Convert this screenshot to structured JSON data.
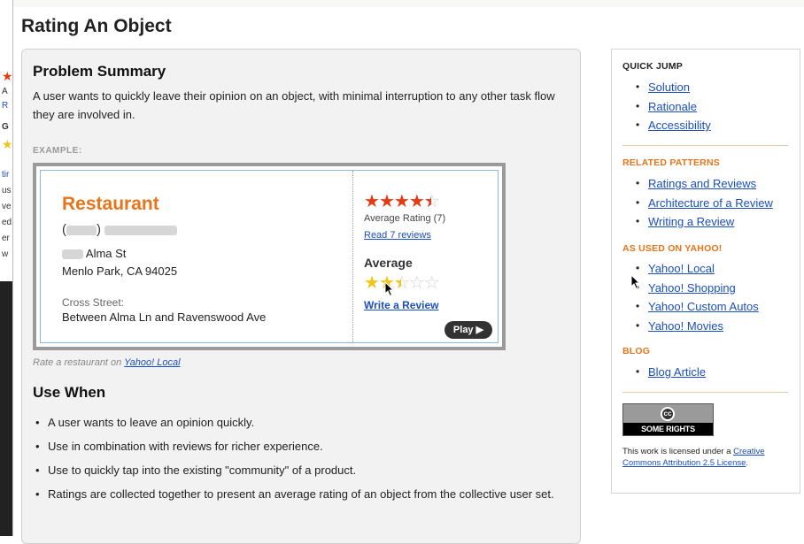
{
  "page": {
    "title": "Rating An Object"
  },
  "problem_summary": {
    "heading": "Problem Summary",
    "text": "A user wants to quickly leave their opinion on an object, with minimal interruption to any other task flow they are involved in."
  },
  "example": {
    "label": "EXAMPLE:",
    "restaurant_name": "Restaurant",
    "street": "Alma St",
    "city": "Menlo Park, CA 94025",
    "cross_street_label": "Cross Street:",
    "cross_street_value": "Between Alma Ln and Ravenswood Ave",
    "avg_rating_stars": 4.5,
    "avg_rating_text": "Average Rating (7)",
    "read_reviews_link": "Read 7 reviews",
    "user_rating_label": "Average",
    "user_rating_stars": 2.5,
    "write_review_link": "Write a Review",
    "play_button": "Play ▶",
    "caption_prefix": "Rate a restaurant on",
    "caption_link": "Yahoo! Local"
  },
  "use_when": {
    "heading": "Use When",
    "items": [
      "A user wants to leave an opinion quickly.",
      "Use in combination with reviews for richer experience.",
      "Use to quickly tap into the existing \"community\" of a product.",
      "Ratings are collected together to present an average rating of an object from the collective user set."
    ]
  },
  "sidebar": {
    "quick_jump": {
      "heading": "QUICK JUMP",
      "items": [
        "Solution",
        "Rationale",
        "Accessibility"
      ]
    },
    "related_patterns": {
      "heading": "RELATED PATTERNS",
      "items": [
        "Ratings and Reviews",
        "Architecture of a Review",
        "Writing a Review"
      ]
    },
    "used_on_yahoo": {
      "heading": "AS USED ON YAHOO!",
      "items": [
        "Yahoo! Local",
        "Yahoo! Shopping",
        "Yahoo! Custom Autos",
        "Yahoo! Movies"
      ]
    },
    "blog": {
      "heading": "BLOG",
      "items": [
        "Blog Article"
      ]
    },
    "cc_badge": {
      "symbol": "cc",
      "text": "SOME RIGHTS RESERVED"
    },
    "license_prefix": "This work is licensed under a",
    "license_link": "Creative Commons Attribution 2.5 License",
    "license_suffix": "."
  },
  "left_window_fragments": [
    "A",
    "R",
    "G",
    "tir",
    "us",
    "ve",
    "ed",
    "er",
    "w"
  ],
  "colors": {
    "accent_orange": "#e8741a",
    "link_blue": "#1a4fbf",
    "star_red": "#e63a12",
    "star_yellow": "#f0c419"
  }
}
